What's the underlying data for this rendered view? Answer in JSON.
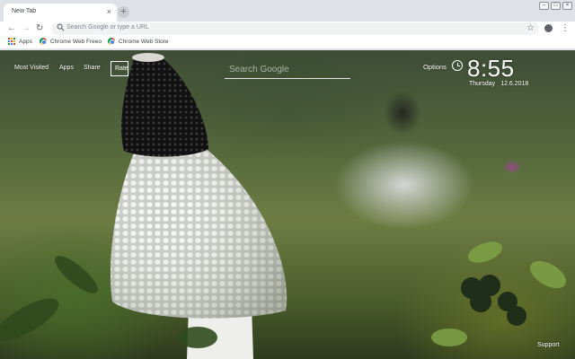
{
  "browser": {
    "tab": {
      "title": "New Tab",
      "close_glyph": "×"
    },
    "new_tab_glyph": "+",
    "window_controls": [
      "–",
      "□",
      "×"
    ],
    "toolbar": {
      "back_glyph": "←",
      "forward_glyph": "→",
      "reload_glyph": "↻",
      "omnibox_placeholder": "Search Google or type a URL",
      "star_glyph": "☆",
      "menu_glyph": "⋮"
    },
    "bookmarks": [
      {
        "label": "Apps",
        "icon": "apps-grid-icon"
      },
      {
        "label": "Chrome Web Freeo",
        "icon": "chrome-web-store-icon"
      },
      {
        "label": "Chrome Web Store",
        "icon": "chrome-web-store-icon"
      }
    ]
  },
  "newtab": {
    "nav": [
      "Most Visited",
      "Apps",
      "Share"
    ],
    "rate_label": "Rate",
    "search_placeholder": "Search Google",
    "options_label": "Options",
    "time": "8:55",
    "day": "Thursday",
    "date": "12.6.2018",
    "support_label": "Support"
  },
  "colors": {
    "tabstrip": "#dee1e6",
    "toolbar": "#ffffff",
    "omnibox": "#f1f3f4",
    "overlay_text": "#ffffff",
    "mushroom_cap": "#1e1e1e",
    "mushroom_veil": "#f2f2f2"
  }
}
